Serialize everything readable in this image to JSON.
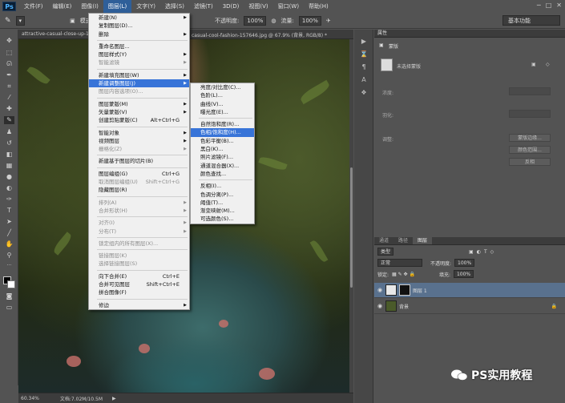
{
  "app": {
    "logo": "Ps"
  },
  "menubar": [
    "文件(F)",
    "编辑(E)",
    "图像(I)",
    "图层(L)",
    "文字(Y)",
    "选择(S)",
    "滤镜(T)",
    "3D(D)",
    "视图(V)",
    "窗口(W)",
    "帮助(H)"
  ],
  "options": {
    "mode_label": "模式:",
    "opacity_label": "不透明度:",
    "opacity_value": "100%",
    "flow_label": "流量:",
    "flow_value": "100%",
    "workspace": "基本功能"
  },
  "document": {
    "tab_left": "attractive-casual-close-up-1",
    "tab_right": "casual-cool-fashion-157646.jpg @ 67.9% (背景, RGB/8) *",
    "zoom": "60.34%",
    "doc_size": "文档:7.02M/10.5M"
  },
  "layer_menu": [
    {
      "label": "新建(N)",
      "arrow": true
    },
    {
      "label": "复制图层(D)..."
    },
    {
      "label": "删除",
      "arrow": true
    },
    {
      "sep": true
    },
    {
      "label": "重命名图层..."
    },
    {
      "label": "图层样式(Y)",
      "arrow": true
    },
    {
      "label": "智能滤镜",
      "arrow": true,
      "disabled": true
    },
    {
      "sep": true
    },
    {
      "label": "新建填充图层(W)",
      "arrow": true
    },
    {
      "label": "新建调整图层(J)",
      "arrow": true,
      "hl": true
    },
    {
      "label": "图层内容选项(O)...",
      "disabled": true
    },
    {
      "sep": true
    },
    {
      "label": "图层蒙版(M)",
      "arrow": true
    },
    {
      "label": "矢量蒙版(V)",
      "arrow": true
    },
    {
      "label": "创建剪贴蒙版(C)",
      "shortcut": "Alt+Ctrl+G"
    },
    {
      "sep": true
    },
    {
      "label": "智能对象",
      "arrow": true
    },
    {
      "label": "视频图层",
      "arrow": true
    },
    {
      "label": "栅格化(Z)",
      "arrow": true,
      "disabled": true
    },
    {
      "sep": true
    },
    {
      "label": "新建基于图层的切片(B)"
    },
    {
      "sep": true
    },
    {
      "label": "图层编组(G)",
      "shortcut": "Ctrl+G"
    },
    {
      "label": "取消图层编组(U)",
      "shortcut": "Shift+Ctrl+G",
      "disabled": true
    },
    {
      "label": "隐藏图层(R)"
    },
    {
      "sep": true
    },
    {
      "label": "排列(A)",
      "arrow": true,
      "disabled": true
    },
    {
      "label": "合并形状(H)",
      "arrow": true,
      "disabled": true
    },
    {
      "sep": true
    },
    {
      "label": "对齐(I)",
      "arrow": true,
      "disabled": true
    },
    {
      "label": "分布(T)",
      "arrow": true,
      "disabled": true
    },
    {
      "sep": true
    },
    {
      "label": "锁定组内的所有图层(X)...",
      "disabled": true
    },
    {
      "sep": true
    },
    {
      "label": "链接图层(K)",
      "disabled": true
    },
    {
      "label": "选择链接图层(S)",
      "disabled": true
    },
    {
      "sep": true
    },
    {
      "label": "向下合并(E)",
      "shortcut": "Ctrl+E"
    },
    {
      "label": "合并可见图层",
      "shortcut": "Shift+Ctrl+E"
    },
    {
      "label": "拼合图像(F)"
    },
    {
      "sep": true
    },
    {
      "label": "修边",
      "arrow": true
    }
  ],
  "adjust_menu": [
    {
      "label": "亮度/对比度(C)..."
    },
    {
      "label": "色阶(L)..."
    },
    {
      "label": "曲线(V)..."
    },
    {
      "label": "曝光度(E)..."
    },
    {
      "sep": true
    },
    {
      "label": "自然饱和度(R)..."
    },
    {
      "label": "色相/饱和度(H)...",
      "hl": true
    },
    {
      "label": "色彩平衡(B)..."
    },
    {
      "label": "黑白(K)..."
    },
    {
      "label": "照片滤镜(F)..."
    },
    {
      "label": "通道混合器(X)..."
    },
    {
      "label": "颜色查找..."
    },
    {
      "sep": true
    },
    {
      "label": "反相(I)..."
    },
    {
      "label": "色调分离(P)..."
    },
    {
      "label": "阈值(T)..."
    },
    {
      "label": "渐变映射(M)..."
    },
    {
      "label": "可选颜色(S)..."
    }
  ],
  "properties": {
    "title": "属性",
    "subtitle": "蒙版",
    "item": "未选择蒙版",
    "density_label": "浓度:",
    "feather_label": "羽化:",
    "refine_label": "调整:",
    "btn1": "蒙版边缘...",
    "btn2": "颜色范围...",
    "btn3": "反相"
  },
  "layers_panel": {
    "tabs": [
      "通道",
      "路径",
      "图层"
    ],
    "filter": "类型",
    "blend": "正常",
    "opacity_label": "不透明度:",
    "opacity_value": "100%",
    "lock_label": "锁定:",
    "fill_label": "填充:",
    "fill_value": "100%",
    "layers": [
      {
        "name": "图层 1",
        "selected": true
      },
      {
        "name": "背景",
        "locked": true
      }
    ]
  },
  "watermark": "PS实用教程",
  "colors": {
    "highlight": "#3874d8",
    "layer_selected": "#59718e",
    "panel": "#535353"
  }
}
